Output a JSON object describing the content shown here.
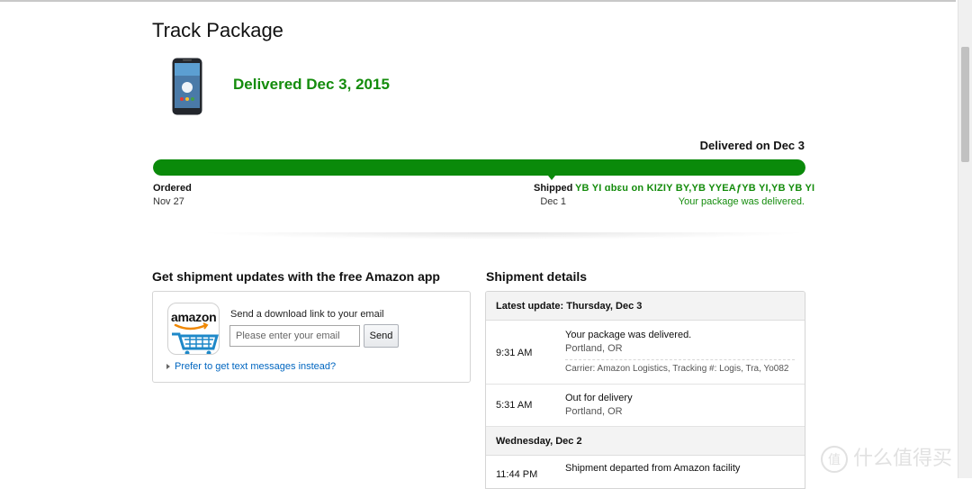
{
  "page": {
    "title": "Track Package"
  },
  "summary": {
    "status_heading": "Delivered Dec 3, 2015"
  },
  "progress": {
    "delivered_on": "Delivered on Dec 3",
    "fraction_complete": 1.0,
    "milestones": [
      {
        "label": "Ordered",
        "date": "Nov 27"
      },
      {
        "label": "Shipped",
        "date": "Dec 1"
      }
    ],
    "render_artifact": "YB YI ɑbɛu on KIZIY BY,YB YYEAƒYB YI,YB YB YI",
    "delivered_note": "Your package was delivered."
  },
  "app_promo": {
    "title": "Get shipment updates with the free Amazon app",
    "icon_text": "amazon",
    "prompt": "Send a download link to your email",
    "email_placeholder": "Please enter your email",
    "send_label": "Send",
    "text_link": "Prefer to get text messages instead?"
  },
  "shipment": {
    "title": "Shipment details",
    "latest_header": "Latest update: Thursday, Dec 3",
    "events": [
      {
        "time": "9:31 AM",
        "desc": "Your package was delivered.",
        "location": "Portland, OR",
        "carrier": "Carrier: Amazon Logistics, Tracking #: Logis, Tra,  Yo",
        "carrier_tail": "082"
      },
      {
        "time": "5:31 AM",
        "desc": "Out for delivery",
        "location": "Portland, OR"
      }
    ],
    "second_header": "Wednesday, Dec 2",
    "events2": [
      {
        "time": "11:44 PM",
        "desc": "Shipment departed from Amazon facility"
      }
    ]
  },
  "watermark": {
    "text": "什么值得买",
    "mark": "值"
  },
  "colors": {
    "accent_green": "#148c0c",
    "progress_green": "#0a8a0a",
    "link_blue": "#0066c0"
  }
}
